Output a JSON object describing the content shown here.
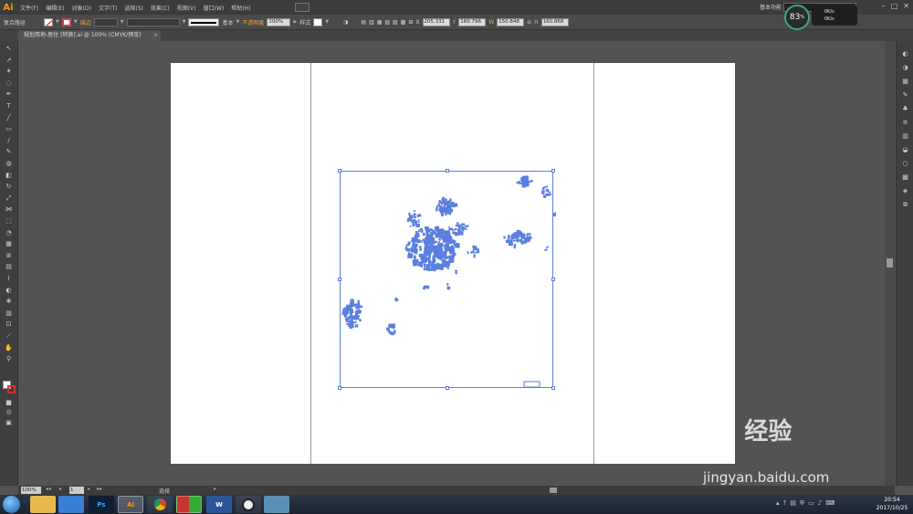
{
  "app": {
    "logo": "Ai"
  },
  "menu": [
    "文件(F)",
    "编辑(E)",
    "对象(O)",
    "文字(T)",
    "选择(S)",
    "效果(C)",
    "视图(V)",
    "窗口(W)",
    "帮助(H)"
  ],
  "workspace": {
    "label": "基本功能"
  },
  "window_controls": [
    "–",
    "□",
    "✕"
  ],
  "control_bar": {
    "object_type": "复合路径",
    "stroke_label": "描边",
    "stroke_profile": "基本",
    "opacity_label": "不透明度",
    "opacity_value": "100%",
    "style_label": "样式",
    "x_value": "205.331",
    "y_value": "160.796",
    "w_value": "150.848",
    "h_value": "160.868"
  },
  "perf_gauge": {
    "percent": "83",
    "unit": "%",
    "up": "0K/s",
    "down": "0K/s"
  },
  "document_tab": {
    "title": "规划用地-居住 [转换].ai @ 100% (CMYK/预览)",
    "close": "×"
  },
  "status_bar": {
    "zoom": "100%",
    "page": "1",
    "tool_label": "选择"
  },
  "taskbar": {
    "apps": [
      {
        "name": "explorer",
        "label": ""
      },
      {
        "name": "app-blue",
        "label": ""
      },
      {
        "name": "photoshop",
        "label": "Ps"
      },
      {
        "name": "illustrator",
        "label": "Ai"
      },
      {
        "name": "chrome",
        "label": ""
      },
      {
        "name": "app-grid",
        "label": ""
      },
      {
        "name": "word",
        "label": "W"
      },
      {
        "name": "app-ball",
        "label": ""
      },
      {
        "name": "app-window",
        "label": ""
      }
    ],
    "time": "20:54",
    "date": "2017/10/25"
  },
  "watermark": {
    "text": "Bai 经验",
    "url": "jingyan.baidu.com"
  },
  "colors": {
    "shape_fill": "#5b7fe0",
    "selection": "#5b7fd8",
    "artboard": "#ffffff",
    "app_bg": "#535353"
  }
}
